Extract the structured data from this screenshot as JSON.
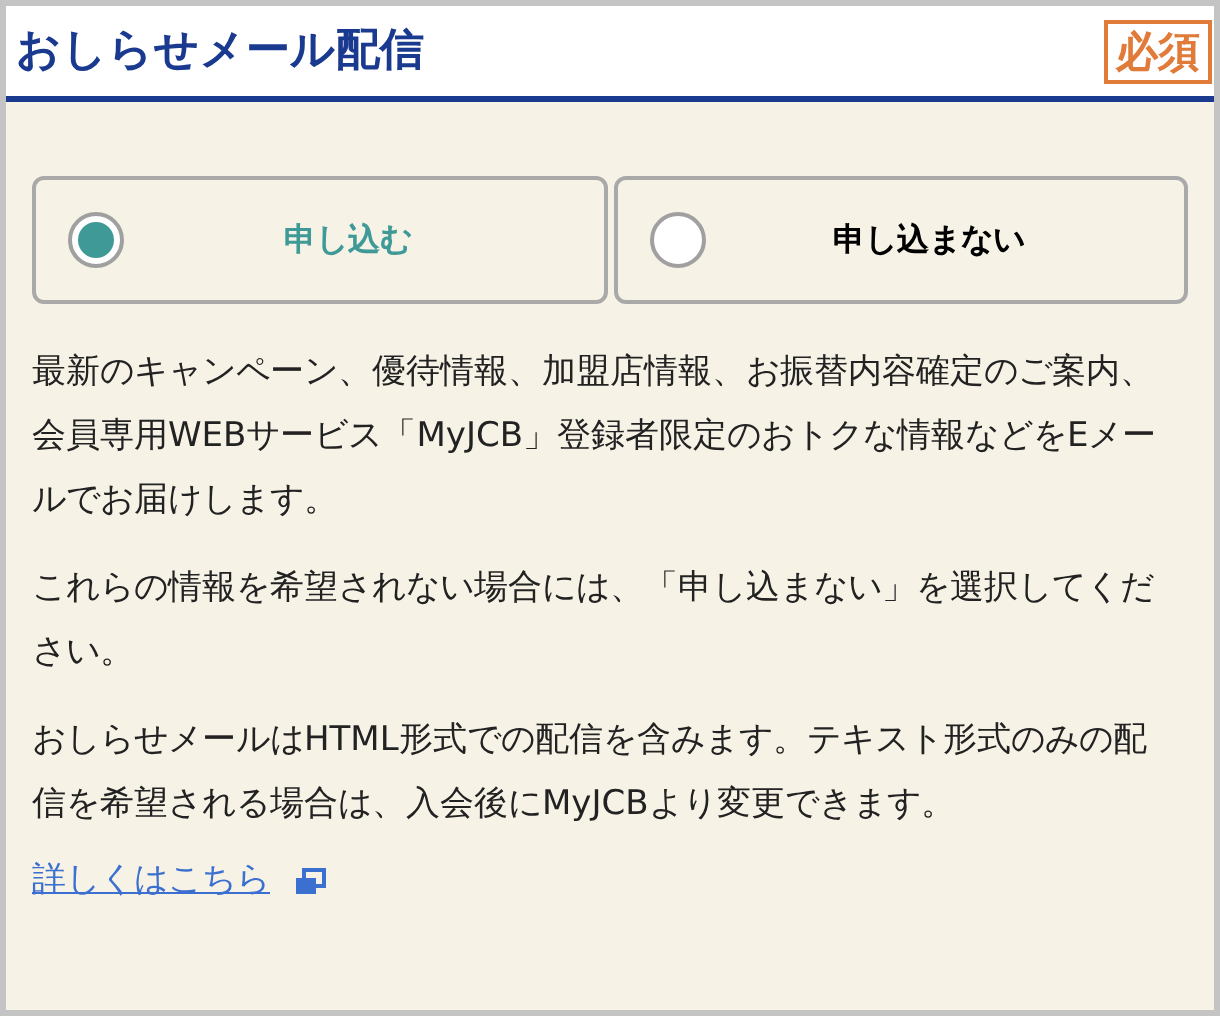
{
  "header": {
    "title": "おしらせメール配信",
    "badge": "必須"
  },
  "options": [
    {
      "label": "申し込む",
      "selected": true
    },
    {
      "label": "申し込まない",
      "selected": false
    }
  ],
  "paragraphs": [
    "最新のキャンペーン、優待情報、加盟店情報、お振替内容確定のご案内、会員専用WEBサービス「MyJCB」登録者限定のおトクな情報などをEメールでお届けします。",
    "これらの情報を希望されない場合には、「申し込まない」を選択してください。",
    "おしらせメールはHTML形式での配信を含みます。テキスト形式のみの配信を希望される場合は、入会後にMyJCBより変更できます。"
  ],
  "link": {
    "label": "詳しくはこちら"
  }
}
